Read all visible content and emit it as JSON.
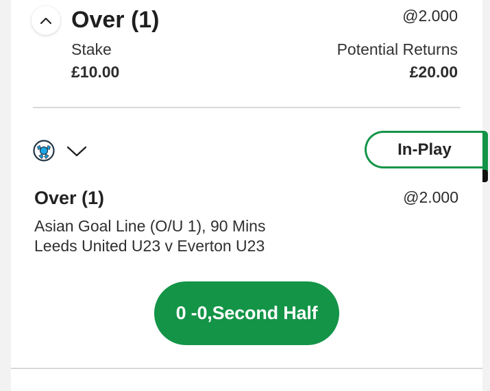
{
  "summary": {
    "selection": "Over (1)",
    "odds": "@2.000",
    "stake_label": "Stake",
    "stake_value": "£10.00",
    "returns_label": "Potential Returns",
    "returns_value": "£20.00"
  },
  "bet": {
    "status_label": "In-Play",
    "selection": "Over (1)",
    "odds": "@2.000",
    "market": "Asian Goal Line (O/U 1), 90 Mins",
    "match": "Leeds United U23 v Everton U23",
    "score_status": "0 -0,Second Half"
  },
  "icons": {
    "collapse": "chevron-up-icon",
    "expand": "chevron-down-icon",
    "sport": "soccer-ball-icon"
  },
  "colors": {
    "accent": "#139447",
    "text": "#1b1b1b",
    "divider": "#d8d8d8"
  }
}
